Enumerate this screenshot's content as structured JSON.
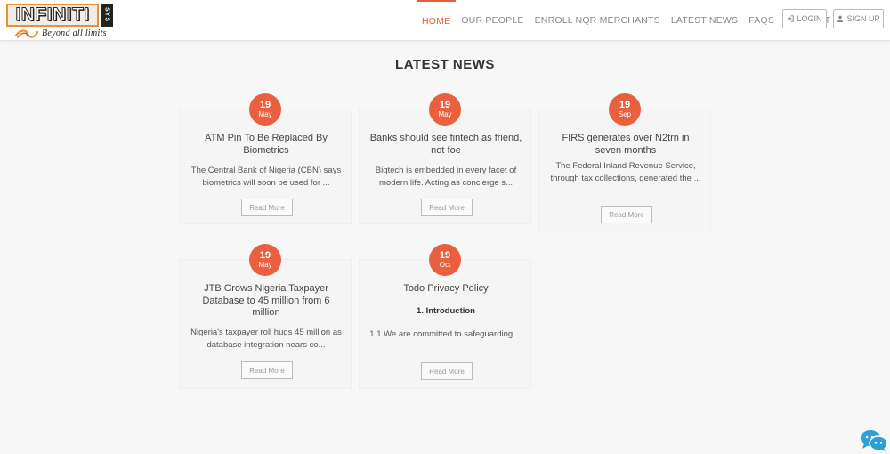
{
  "brand": {
    "logo_word": "INFINITI",
    "logo_suffix": "SYS",
    "tagline": "Beyond all limits",
    "accent_color": "#e9603f",
    "logo_orange": "#e8913a"
  },
  "nav": {
    "items": [
      {
        "label": "HOME",
        "active": true
      },
      {
        "label": "OUR PEOPLE"
      },
      {
        "label": "ENROLL NQR MERCHANTS"
      },
      {
        "label": "LATEST NEWS"
      },
      {
        "label": "FAQS"
      },
      {
        "label": "CONTACT"
      }
    ],
    "login_label": "LOGIN",
    "signup_label": "SIGN UP"
  },
  "news": {
    "section_title": "LATEST NEWS",
    "read_more_label": "Read More",
    "cards": [
      {
        "day": "19",
        "month": "May",
        "title": "ATM Pin To Be Replaced By Biometrics",
        "excerpt": "The Central Bank of Nigeria (CBN) says biometrics will soon be used for ..."
      },
      {
        "day": "19",
        "month": "May",
        "title": "Banks should see fintech as friend, not foe",
        "excerpt": "Bigtech is embedded in every facet of modern life. Acting as concierge s..."
      },
      {
        "day": "19",
        "month": "Sep",
        "title": "FIRS generates over N2trn in seven months",
        "excerpt": "The Federal Inland Revenue Service, through tax collections, generated the ..."
      },
      {
        "day": "19",
        "month": "May",
        "title": "JTB Grows Nigeria Taxpayer Database to 45 million from 6 million",
        "excerpt": "Nigeria's taxpayer roll hugs 45 million as database integration nears co..."
      },
      {
        "day": "19",
        "month": "Oct",
        "title": "Todo Privacy Policy",
        "subheading": "1. Introduction",
        "excerpt": "1.1 We are committed to safeguarding ..."
      }
    ]
  }
}
